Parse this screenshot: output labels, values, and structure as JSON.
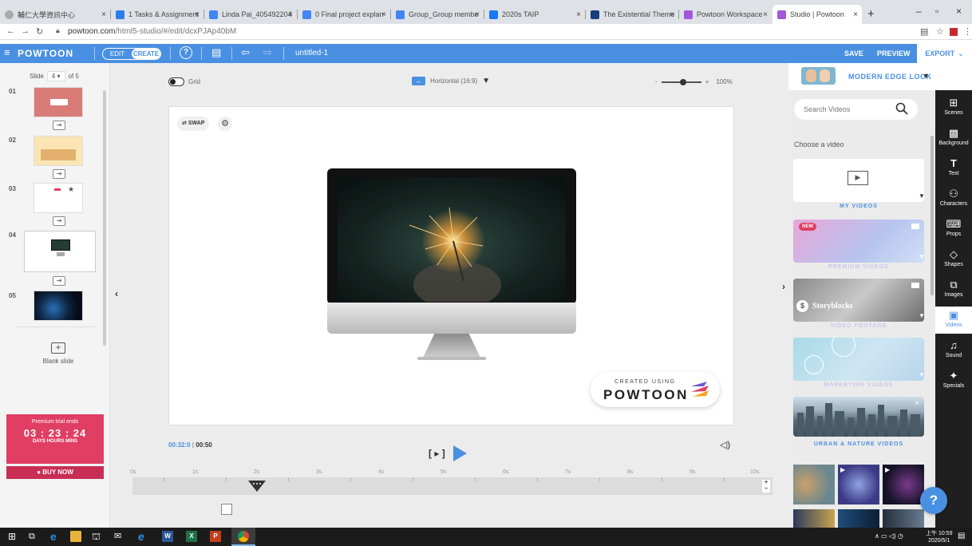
{
  "browser": {
    "tabs": [
      {
        "title": "輔仁大學資訊中心",
        "active": false
      },
      {
        "title": "1 Tasks & Assignment",
        "active": false
      },
      {
        "title": "Linda Pai_405492204",
        "active": false
      },
      {
        "title": "0 Final project explan",
        "active": false
      },
      {
        "title": "Group_Group membe",
        "active": false
      },
      {
        "title": "2020s TAIP",
        "active": false
      },
      {
        "title": "The Existential Theme",
        "active": false
      },
      {
        "title": "Powtoon Workspace",
        "active": false
      },
      {
        "title": "Studio | Powtoon",
        "active": true
      }
    ],
    "url_host": "powtoon.com",
    "url_path": "/html5-studio/#/edit/dcxPJAp40bM"
  },
  "app": {
    "logo": "POWTOON",
    "mode_edit": "EDIT",
    "mode_create": "CREATE",
    "doc_title": "untitled-1",
    "save": "SAVE",
    "preview": "PREVIEW",
    "export": "EXPORT"
  },
  "slides": {
    "label": "Slide",
    "current": "4",
    "total": "of 5",
    "numbers": [
      "01",
      "02",
      "03",
      "04",
      "05"
    ],
    "blank_label": "Blank slide"
  },
  "premium": {
    "line1": "Premium trial ends",
    "countdown": "03 : 23 : 24",
    "units": "DAYS  HOURS MINS",
    "buy": "BUY NOW"
  },
  "toolbar": {
    "grid_label": "Grid",
    "orientation": "Horizontal (16:9)",
    "zoom_minus": "-",
    "zoom_plus": "+",
    "zoom": "100%"
  },
  "canvas": {
    "swap": "⇄ SWAP",
    "watermark_top": "CREATED USING",
    "watermark_brand": "POWTOON"
  },
  "timeline": {
    "current_time": "00:32:0",
    "separator": " | ",
    "total_time": "00:50",
    "ticks": [
      "0s",
      "1s",
      "2s",
      "3s",
      "4s",
      "5s",
      "6s",
      "7s",
      "8s",
      "9s",
      "10s"
    ],
    "play_bracket": "[ ▸ ]"
  },
  "right_panel": {
    "look_title": "MODERN EDGE LOOK",
    "search_placeholder": "Search Videos",
    "choose_label": "Choose a video",
    "cards": [
      {
        "label": "MY VIDEOS",
        "badge": ""
      },
      {
        "label": "PREMIUM VIDEOS",
        "badge": "NEW"
      },
      {
        "label": "VIDEO FOOTAGE",
        "badge": "Storyblocks"
      },
      {
        "label": "MARKETING VIDEOS",
        "badge": ""
      },
      {
        "label": "URBAN & NATURE VIDEOS",
        "badge": ""
      }
    ]
  },
  "categories": [
    {
      "label": "Scenes",
      "icon": "scenes-icon"
    },
    {
      "label": "Background",
      "icon": "background-icon"
    },
    {
      "label": "Text",
      "icon": "text-icon"
    },
    {
      "label": "Characters",
      "icon": "characters-icon"
    },
    {
      "label": "Props",
      "icon": "props-icon"
    },
    {
      "label": "Shapes",
      "icon": "shapes-icon"
    },
    {
      "label": "Images",
      "icon": "images-icon"
    },
    {
      "label": "Videos",
      "icon": "videos-icon"
    },
    {
      "label": "Sound",
      "icon": "sound-icon"
    },
    {
      "label": "Specials",
      "icon": "specials-icon"
    }
  ],
  "taskbar": {
    "time": "上午 10:59",
    "date": "2020/5/1"
  },
  "colors": {
    "brand_blue": "#4a90e2",
    "premium_pink": "#e03e63",
    "sidebar_dark": "#1f1f1f"
  }
}
